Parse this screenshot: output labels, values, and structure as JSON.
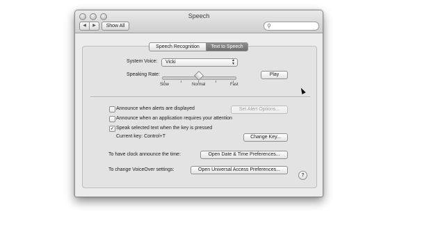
{
  "window": {
    "title": "Speech"
  },
  "toolbar": {
    "back_glyph": "◀",
    "forward_glyph": "▶",
    "show_all_label": "Show All",
    "search_icon": "magnifier-icon",
    "search_value": ""
  },
  "tabs": [
    {
      "label": "Speech Recognition",
      "selected": false
    },
    {
      "label": "Text to Speech",
      "selected": true
    }
  ],
  "voice": {
    "label": "System Voice:",
    "value": "Vicki"
  },
  "rate": {
    "label": "Speaking Rate:",
    "level": 0.5,
    "min_label": "Slow",
    "mid_label": "Normal",
    "max_label": "Fast"
  },
  "play_button": "Play",
  "options": {
    "alerts": {
      "label": "Announce when alerts are displayed",
      "checked": false
    },
    "set_alert_button": "Set Alert Options...",
    "app_attention": {
      "label": "Announce when an application requires your attention",
      "checked": false
    },
    "speak_selected": {
      "label": "Speak selected text when the key is pressed",
      "checked": true
    },
    "current_key": "Current key: Control+T",
    "change_key_button": "Change Key..."
  },
  "clock": {
    "label": "To have clock announce the time:",
    "button": "Open Date & Time Preferences..."
  },
  "voiceover": {
    "label": "To change VoiceOver settings:",
    "button": "Open Universal Access Preferences..."
  },
  "help_glyph": "?",
  "checkmark": "✓"
}
